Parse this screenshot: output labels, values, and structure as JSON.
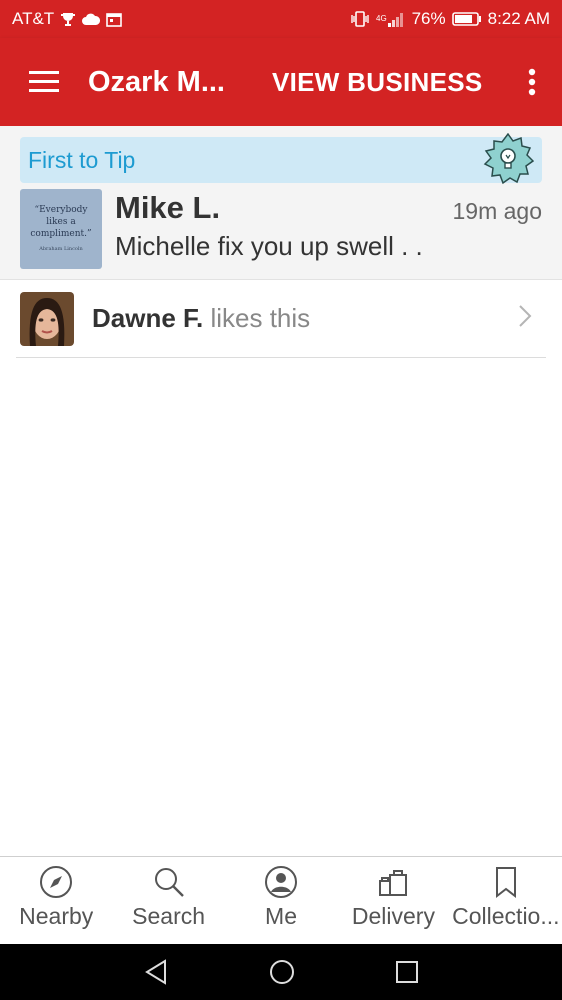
{
  "status_bar": {
    "carrier": "AT&T",
    "battery": "76%",
    "time": "8:22 AM",
    "icons": [
      "trophy-icon",
      "cloud-icon",
      "calendar-icon",
      "vibrate-icon",
      "4g-signal-icon",
      "battery-icon"
    ]
  },
  "app_bar": {
    "title": "Ozark M...",
    "action": "VIEW BUSINESS",
    "icons": [
      "menu-icon",
      "overflow-menu-icon"
    ]
  },
  "tip": {
    "banner": "First to Tip",
    "author": "Mike L.",
    "time_ago": "19m ago",
    "text": "Michelle fix you up swell . .",
    "thumb_text": "“Everybody likes a compliment.”",
    "thumb_caption": "Abraham Lincoln"
  },
  "likes": {
    "name": "Dawne F.",
    "suffix": " likes this"
  },
  "bottom_nav": {
    "items": [
      {
        "label": "Nearby",
        "icon": "compass-icon"
      },
      {
        "label": "Search",
        "icon": "search-icon"
      },
      {
        "label": "Me",
        "icon": "profile-icon"
      },
      {
        "label": "Delivery",
        "icon": "delivery-icon"
      },
      {
        "label": "Collectio...",
        "icon": "bookmark-icon"
      }
    ]
  },
  "colors": {
    "brand": "#d32323",
    "banner_bg": "#cfe9f6",
    "banner_text": "#1d9bd1"
  }
}
